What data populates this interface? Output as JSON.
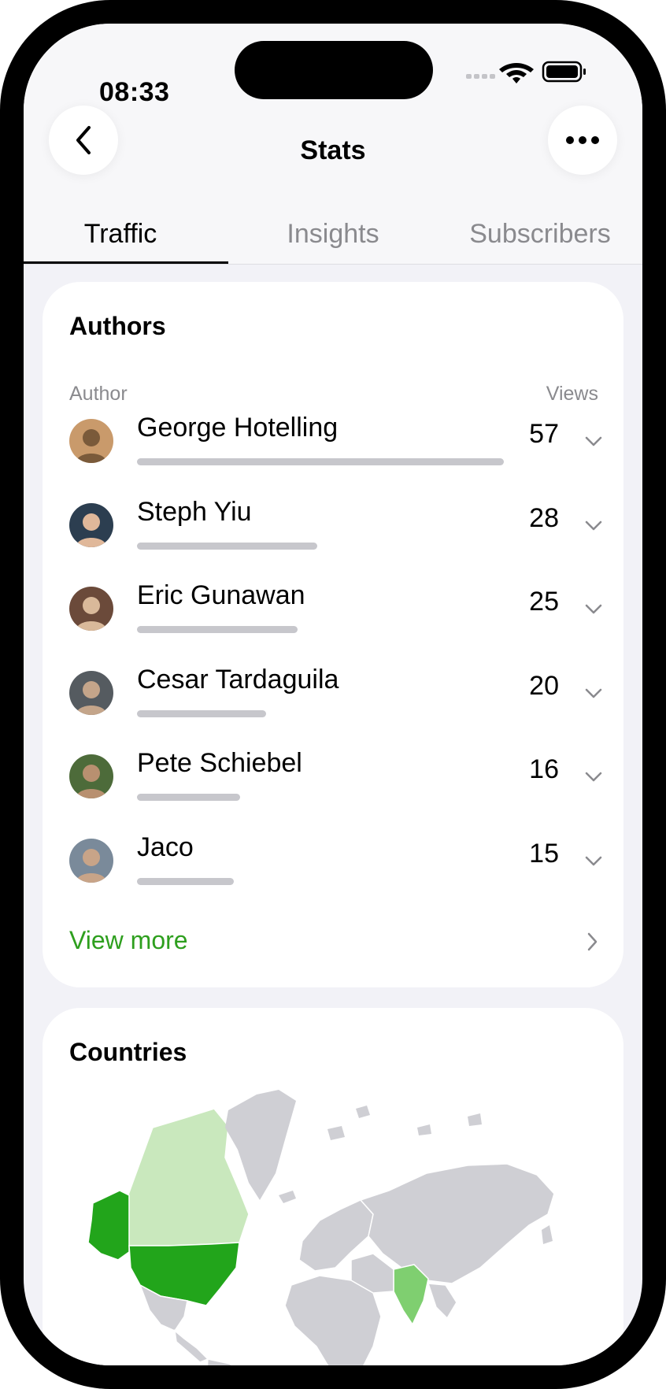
{
  "status_bar": {
    "time": "08:33"
  },
  "header": {
    "title": "Stats"
  },
  "tabs": [
    {
      "label": "Traffic",
      "active": true
    },
    {
      "label": "Insights",
      "active": false
    },
    {
      "label": "Subscribers",
      "active": false
    }
  ],
  "authors": {
    "title": "Authors",
    "col_author": "Author",
    "col_views": "Views",
    "max_views": 57,
    "items": [
      {
        "name": "George Hotelling",
        "views": "57"
      },
      {
        "name": "Steph Yiu",
        "views": "28"
      },
      {
        "name": "Eric Gunawan",
        "views": "25"
      },
      {
        "name": "Cesar Tardaguila",
        "views": "20"
      },
      {
        "name": "Pete Schiebel",
        "views": "16"
      },
      {
        "name": "Jaco",
        "views": "15"
      }
    ],
    "view_more": "View more"
  },
  "countries": {
    "title": "Countries"
  },
  "colors": {
    "accent": "#2e9f1e",
    "map_highlight": "#22a51b",
    "map_medium": "#7fcf70",
    "map_light": "#c9e8bd",
    "map_base": "#cfcfd4"
  }
}
